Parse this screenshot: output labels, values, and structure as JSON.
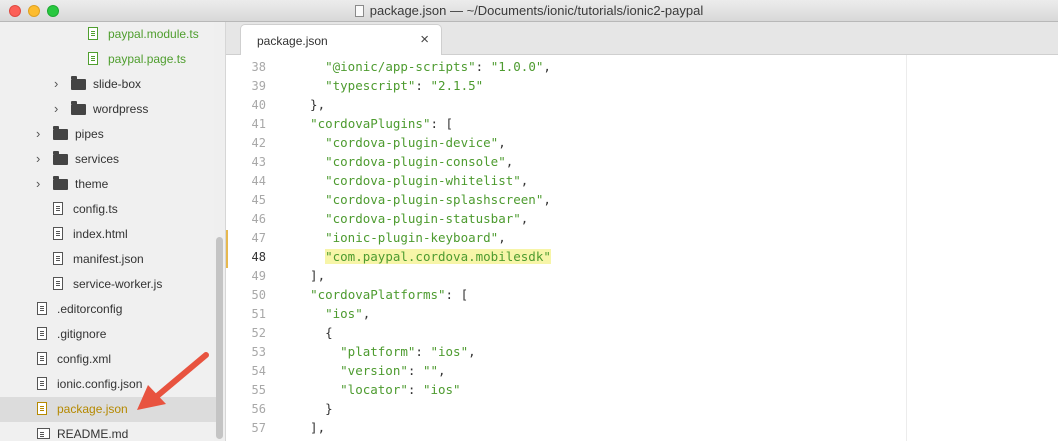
{
  "window": {
    "title": "package.json — ~/Documents/ionic/tutorials/ionic2-paypal"
  },
  "sidebar": {
    "items": [
      {
        "label": "paypal.module.ts",
        "kind": "file",
        "indent": 3,
        "color": "green"
      },
      {
        "label": "paypal.page.ts",
        "kind": "file",
        "indent": 3,
        "color": "green"
      },
      {
        "label": "slide-box",
        "kind": "folder",
        "indent": 2
      },
      {
        "label": "wordpress",
        "kind": "folder",
        "indent": 2
      },
      {
        "label": "pipes",
        "kind": "folder",
        "indent": 1
      },
      {
        "label": "services",
        "kind": "folder",
        "indent": 1
      },
      {
        "label": "theme",
        "kind": "folder",
        "indent": 1
      },
      {
        "label": "config.ts",
        "kind": "file",
        "indent": 1
      },
      {
        "label": "index.html",
        "kind": "file",
        "indent": 1
      },
      {
        "label": "manifest.json",
        "kind": "file",
        "indent": 1
      },
      {
        "label": "service-worker.js",
        "kind": "file",
        "indent": 1
      },
      {
        "label": ".editorconfig",
        "kind": "file",
        "indent": 0
      },
      {
        "label": ".gitignore",
        "kind": "file",
        "indent": 0
      },
      {
        "label": "config.xml",
        "kind": "file",
        "indent": 0
      },
      {
        "label": "ionic.config.json",
        "kind": "file",
        "indent": 0
      },
      {
        "label": "package.json",
        "kind": "file",
        "indent": 0,
        "selected": true
      },
      {
        "label": "README.md",
        "kind": "file",
        "indent": 0
      }
    ]
  },
  "tabs": [
    {
      "label": "package.json",
      "close": "×"
    }
  ],
  "editor": {
    "active_line": "48",
    "lines": [
      {
        "num": "38",
        "text": "    \"@ionic/app-scripts\": \"1.0.0\","
      },
      {
        "num": "39",
        "text": "    \"typescript\": \"2.1.5\""
      },
      {
        "num": "40",
        "text": "  },"
      },
      {
        "num": "41",
        "text": "  \"cordovaPlugins\": ["
      },
      {
        "num": "42",
        "text": "    \"cordova-plugin-device\","
      },
      {
        "num": "43",
        "text": "    \"cordova-plugin-console\","
      },
      {
        "num": "44",
        "text": "    \"cordova-plugin-whitelist\","
      },
      {
        "num": "45",
        "text": "    \"cordova-plugin-splashscreen\","
      },
      {
        "num": "46",
        "text": "    \"cordova-plugin-statusbar\","
      },
      {
        "num": "47",
        "text": "    \"ionic-plugin-keyboard\","
      },
      {
        "num": "48",
        "text": "    \"com.paypal.cordova.mobilesdk\""
      },
      {
        "num": "49",
        "text": "  ],"
      },
      {
        "num": "50",
        "text": "  \"cordovaPlatforms\": ["
      },
      {
        "num": "51",
        "text": "    \"ios\","
      },
      {
        "num": "52",
        "text": "    {"
      },
      {
        "num": "53",
        "text": "      \"platform\": \"ios\","
      },
      {
        "num": "54",
        "text": "      \"version\": \"\","
      },
      {
        "num": "55",
        "text": "      \"locator\": \"ios\""
      },
      {
        "num": "56",
        "text": "    }"
      },
      {
        "num": "57",
        "text": "  ],"
      }
    ]
  },
  "colors": {
    "string": "#4d9b2f",
    "highlight": "#f7f5a8",
    "selected_file": "#b58900",
    "arrow": "#e8533f"
  }
}
